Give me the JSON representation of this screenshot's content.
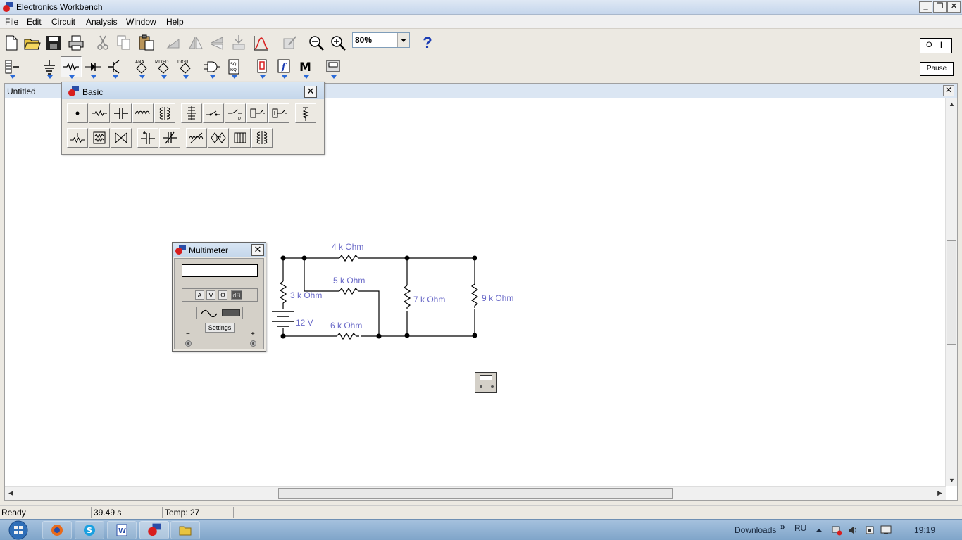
{
  "window": {
    "title": "Electronics Workbench",
    "min_glyph": "_",
    "max_glyph": "❐",
    "close_glyph": "✕"
  },
  "menu": [
    "File",
    "Edit",
    "Circuit",
    "Analysis",
    "Window",
    "Help"
  ],
  "toolbar": {
    "zoom_value": "80%",
    "help_glyph": "?",
    "pause_label": "Pause",
    "power_off_glyph": "O",
    "power_on_glyph": "I",
    "parts_bins": [
      {
        "name": "sources",
        "icon": "ground-source-icon"
      },
      {
        "name": "basic",
        "icon": "resistor-icon"
      },
      {
        "name": "diodes",
        "icon": "diode-icon"
      },
      {
        "name": "transistors",
        "icon": "transistor-icon"
      },
      {
        "name": "analog-ics",
        "icon": "ana-ic-icon",
        "tag": "ANA"
      },
      {
        "name": "mixed-ics",
        "icon": "mixed-ic-icon",
        "tag": "MIXED"
      },
      {
        "name": "digital-ics",
        "icon": "digit-ic-icon",
        "tag": "DIGIT"
      },
      {
        "name": "logic-gates",
        "icon": "logic-gate-icon"
      },
      {
        "name": "digital",
        "icon": "flipflop-icon"
      },
      {
        "name": "indicators",
        "icon": "indicator-icon"
      },
      {
        "name": "controls",
        "icon": "controls-icon",
        "tag": "f"
      },
      {
        "name": "miscellaneous",
        "icon": "misc-icon",
        "tag": "M"
      },
      {
        "name": "instruments",
        "icon": "instruments-icon"
      }
    ]
  },
  "document": {
    "title": "Untitled",
    "close_glyph": "✕",
    "scroll_up": "▲",
    "scroll_down": "▼",
    "scroll_left": "◀",
    "scroll_right": "▶"
  },
  "palette": {
    "title": "Basic",
    "close_glyph": "✕"
  },
  "multimeter": {
    "title": "Multimeter",
    "close_glyph": "✕",
    "display_value": "",
    "modes": [
      "A",
      "V",
      "Ω",
      "dB"
    ],
    "settings_label": "Settings",
    "minus": "−",
    "plus": "+"
  },
  "circuit": {
    "labels": {
      "r4": "4 k Ohm",
      "r5": "5 k Ohm",
      "r6": "6 k Ohm",
      "r3": "3 k Ohm",
      "r7": "7 k Ohm",
      "r9": "9 k Ohm",
      "battery": "12 V"
    }
  },
  "statusbar": {
    "status": "Ready",
    "time": "39.49 s",
    "temp": "Temp:  27"
  },
  "taskbar": {
    "downloads": "Downloads",
    "chevrons": "»",
    "language": "RU",
    "clock": "19:19"
  },
  "colors": {
    "label_blue": "#6a6ac8",
    "accent": "#2a6ad8"
  }
}
